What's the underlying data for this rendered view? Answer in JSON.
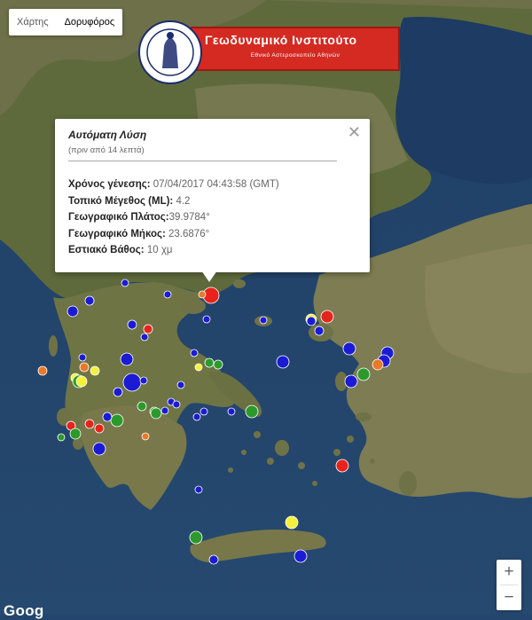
{
  "map_type": {
    "map_label": "Χάρτης",
    "satellite_label": "Δορυφόρος",
    "active": "satellite"
  },
  "logo": {
    "title": "Γεωδυναμικό Ινστιτούτο",
    "subtitle": "Εθνικό Αστεροσκοπείο Αθηνών"
  },
  "popup": {
    "heading": "Αυτόματη Λύση",
    "ago": "(πριν από 14 λεπτά)",
    "rows": [
      {
        "label": "Χρόνος γένεσης:",
        "value": "07/04/2017 04:43:58 (GMT)"
      },
      {
        "label": "Τοπικό Μέγεθος (ML):",
        "value": "4.2"
      },
      {
        "label": "Γεωγραφικό Πλάτος:",
        "value": "39.9784°"
      },
      {
        "label": "Γεωγραφικό Μήκος:",
        "value": "23.6876°"
      },
      {
        "label": "Εστιακό Βάθος:",
        "value": "10 χμ"
      }
    ],
    "close_icon": "close-icon"
  },
  "zoom": {
    "in": "+",
    "out": "−"
  },
  "attribution": "Goog",
  "legend_colors": {
    "red": "#e8231c",
    "orange": "#e87a2a",
    "yellow": "#f4f13c",
    "green": "#2b9a2b",
    "blue": "#1b1bd6"
  }
}
